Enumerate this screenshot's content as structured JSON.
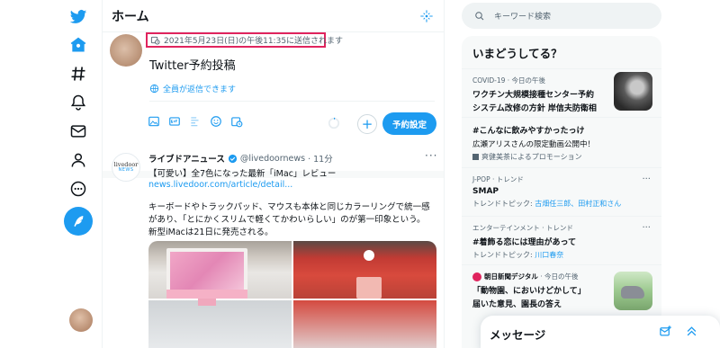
{
  "main": {
    "title": "ホーム",
    "composer": {
      "schedule_notice": "2021年5月23日(日)の午後11:35に送信されます",
      "text": "Twitter予約投稿",
      "reply_setting": "全員が返信できます",
      "schedule_button": "予約設定",
      "add_button": "+"
    },
    "tweet": {
      "avatar_text": "livedoor",
      "avatar_sub": "NEWS",
      "name": "ライブドアニュース",
      "handle": "@livedoornews",
      "time": "· 11分",
      "more": "···",
      "line1": "【可愛い】全7色になった最新「iMac」レビュー",
      "link": "news.livedoor.com/article/detail...",
      "line3": "キーボードやトラックパッド、マウスも本体と同じカラーリングで統一感",
      "line4": "があり、「とにかくスリムで軽くてかわいらしい」のが第一印象という。",
      "line5": "新型iMacは21日に発売される。"
    }
  },
  "right": {
    "search_placeholder": "キーワード検索",
    "trends_title": "いまどうしてる？",
    "trends": [
      {
        "meta": "COVID-19 · 今日の午後",
        "title1": "ワクチン大規模接種センター予約",
        "title2": "システム改修の方針 岸信夫防衛相"
      },
      {
        "title": "#こんなに飲みやすかったっけ",
        "sub": "広瀬アリスさんの限定動画公開中！",
        "promo": "爽健美茶によるプロモーション"
      },
      {
        "meta": "J-POP · トレンド",
        "title": "SMAP",
        "sub_prefix": "トレンドトピック: ",
        "sub_link": "古畑任三郎、田村正和さん",
        "more": "···"
      },
      {
        "meta": "エンターテインメント · トレンド",
        "title": "#着飾る恋には理由があって",
        "sub_prefix": "トレンドトピック: ",
        "sub_link": "川口春奈",
        "more": "···"
      },
      {
        "source": "朝日新聞デジタル",
        "meta": "· 今日の午後",
        "title1": "「動物園、においけどかして」",
        "title2": "届いた意見、園長の答え"
      }
    ]
  },
  "messages": {
    "title": "メッセージ"
  },
  "colors": {
    "accent": "#1d9bf0",
    "highlight_border": "#e0245e"
  },
  "icons": [
    "twitter-logo-icon",
    "home-icon",
    "hashtag-icon",
    "bell-icon",
    "mail-icon",
    "person-icon",
    "more-circle-icon",
    "compose-tweet-icon",
    "sparkle-icon",
    "calendar-clock-icon",
    "globe-icon",
    "image-icon",
    "gif-icon",
    "poll-icon",
    "emoji-icon",
    "schedule-icon",
    "verified-badge-icon",
    "search-icon",
    "new-message-icon",
    "chevron-up-double-icon"
  ]
}
